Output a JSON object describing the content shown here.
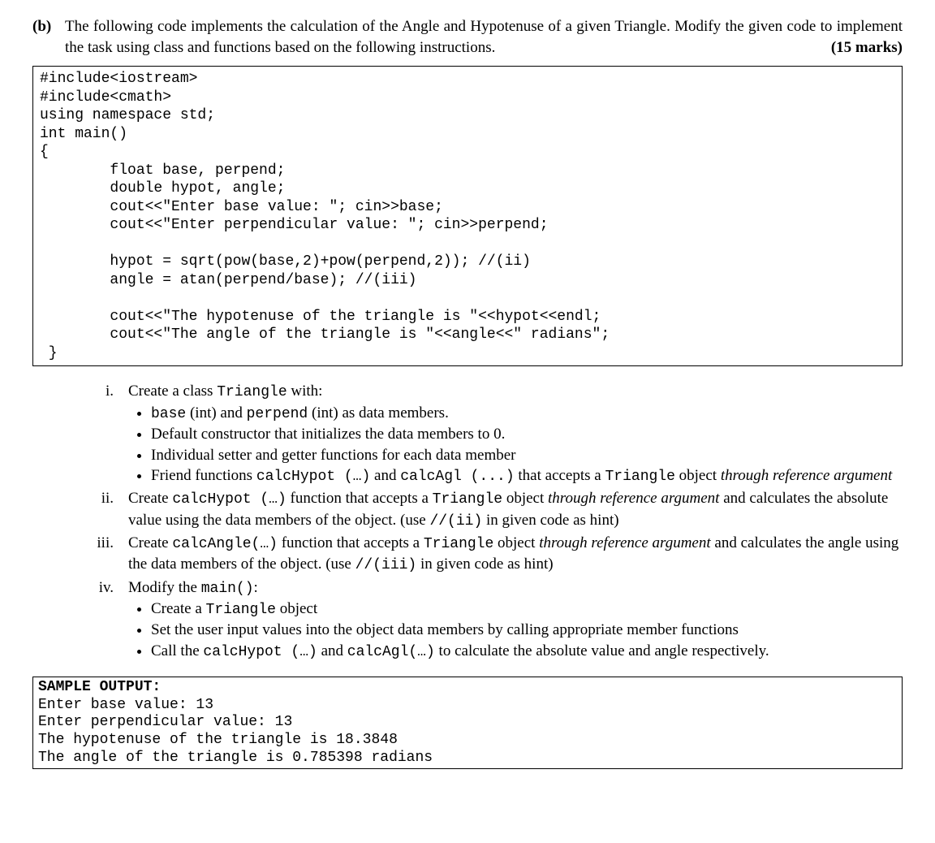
{
  "question": {
    "label": "(b)",
    "text_before_marks": "The following code implements the calculation of the Angle and Hypotenuse of a given Triangle. Modify the given code to implement the task using class and functions based on the following instructions.",
    "marks": "(15 marks)"
  },
  "code_box": "#include<iostream>\n#include<cmath>\nusing namespace std;\nint main()\n{\n        float base, perpend;\n        double hypot, angle;\n        cout<<\"Enter base value: \"; cin>>base;\n        cout<<\"Enter perpendicular value: \"; cin>>perpend;\n\n        hypot = sqrt(pow(base,2)+pow(perpend,2)); //(ii)\n        angle = atan(perpend/base); //(iii)\n\n        cout<<\"The hypotenuse of the triangle is \"<<hypot<<endl;\n        cout<<\"The angle of the triangle is \"<<angle<<\" radians\";\n }",
  "instr": {
    "i": {
      "num": "i.",
      "lead_a": "Create a class ",
      "lead_b": "Triangle",
      "lead_c": " with:",
      "b1_a": "base",
      "b1_b": " (int) and ",
      "b1_c": "perpend",
      "b1_d": " (int) as data members.",
      "b2": "Default constructor that initializes the data members to 0.",
      "b3": "Individual setter and getter functions for each data member",
      "b4_a": "Friend functions ",
      "b4_b": "calcHypot (…)",
      "b4_c": " and ",
      "b4_d": "calcAgl (...)",
      "b4_e": " that accepts a ",
      "b4_f": "Triangle",
      "b4_g": " object ",
      "b4_h": "through reference argument"
    },
    "ii": {
      "num": "ii.",
      "a": "Create ",
      "b": "calcHypot (…)",
      "c": " function that accepts a ",
      "d": "Triangle",
      "e": " object ",
      "f": "through reference argument",
      "g": " and calculates the absolute value using the data members of the object. (use ",
      "h": "//(ii)",
      "i": " in given code as hint)"
    },
    "iii": {
      "num": "iii.",
      "a": "Create ",
      "b": "calcAngle(…)",
      "c": " function that accepts a ",
      "d": "Triangle",
      "e": " object ",
      "f": "through reference argument",
      "g": " and calculates the angle using the data members of the object. (use ",
      "h": "//(iii)",
      "i": " in given code as hint)"
    },
    "iv": {
      "num": "iv.",
      "lead_a": "Modify the ",
      "lead_b": "main()",
      "lead_c": ":",
      "b1_a": "Create a ",
      "b1_b": "Triangle",
      "b1_c": " object",
      "b2": "Set the user input values into the object data members by calling appropriate member functions",
      "b3_a": "Call the ",
      "b3_b": "calcHypot (…)",
      "b3_c": "  and ",
      "b3_d": "calcAgl(…)",
      "b3_e": "  to calculate the absolute value and angle respectively."
    }
  },
  "sample": {
    "header": "SAMPLE OUTPUT:",
    "body": "Enter base value: 13\nEnter perpendicular value: 13\nThe hypotenuse of the triangle is 18.3848\nThe angle of the triangle is 0.785398 radians"
  }
}
